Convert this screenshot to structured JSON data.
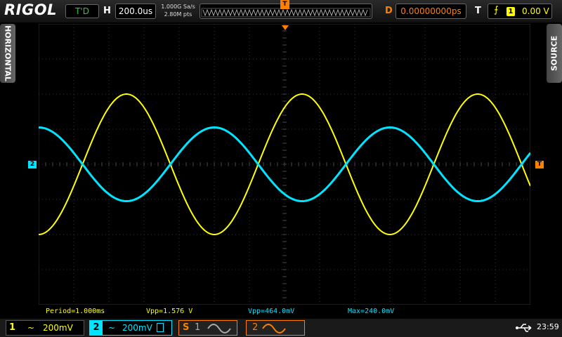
{
  "header": {
    "brand": "RIGOL",
    "run_status": "T'D",
    "horizontal_label": "H",
    "timebase": "200.0us",
    "sample_rate": "1.000G Sa/s",
    "memory_depth": "2.80M pts",
    "trigger_position_marker": "T",
    "delay_label": "D",
    "delay": "0.00000000ps",
    "trigger_label": "T",
    "trigger_source": "1",
    "trigger_level": "0.00 V",
    "trigger_edge_icon": "rising-edge-icon"
  },
  "side_tabs": {
    "left": "HORIZONTAL",
    "right": "SOURCE"
  },
  "markers": {
    "ch2": "2",
    "trigger_level": "T"
  },
  "measurements": {
    "period": "Period=1.000ms",
    "vpp_ch1": "Vpp=1.576 V",
    "vpp_ch2": "Vpp=464.0mV",
    "max_ch2": "Max=240.0mV"
  },
  "channels": [
    {
      "number": "1",
      "coupling": "~",
      "scale": "200mV",
      "color": "#ffff00"
    },
    {
      "number": "2",
      "coupling": "~",
      "scale": "200mV",
      "color": "#00e5ff"
    }
  ],
  "math": [
    {
      "prefix": "S",
      "number": "1",
      "icon": "sine-wave-icon",
      "color": "#aaaaaa"
    },
    {
      "prefix": "",
      "number": "2",
      "icon": "sine-wave-icon",
      "color": "#ff7f00"
    }
  ],
  "status": {
    "usb_icon": "usb-icon",
    "time": "23:59"
  },
  "waveforms": {
    "ch1": {
      "vpp_div": 4.0,
      "periods_per_screen": 2.8,
      "phase_start_deg": 270
    },
    "ch2": {
      "vpp_div": 2.1,
      "periods_per_screen": 2.8,
      "phase_start_deg": 90
    }
  }
}
